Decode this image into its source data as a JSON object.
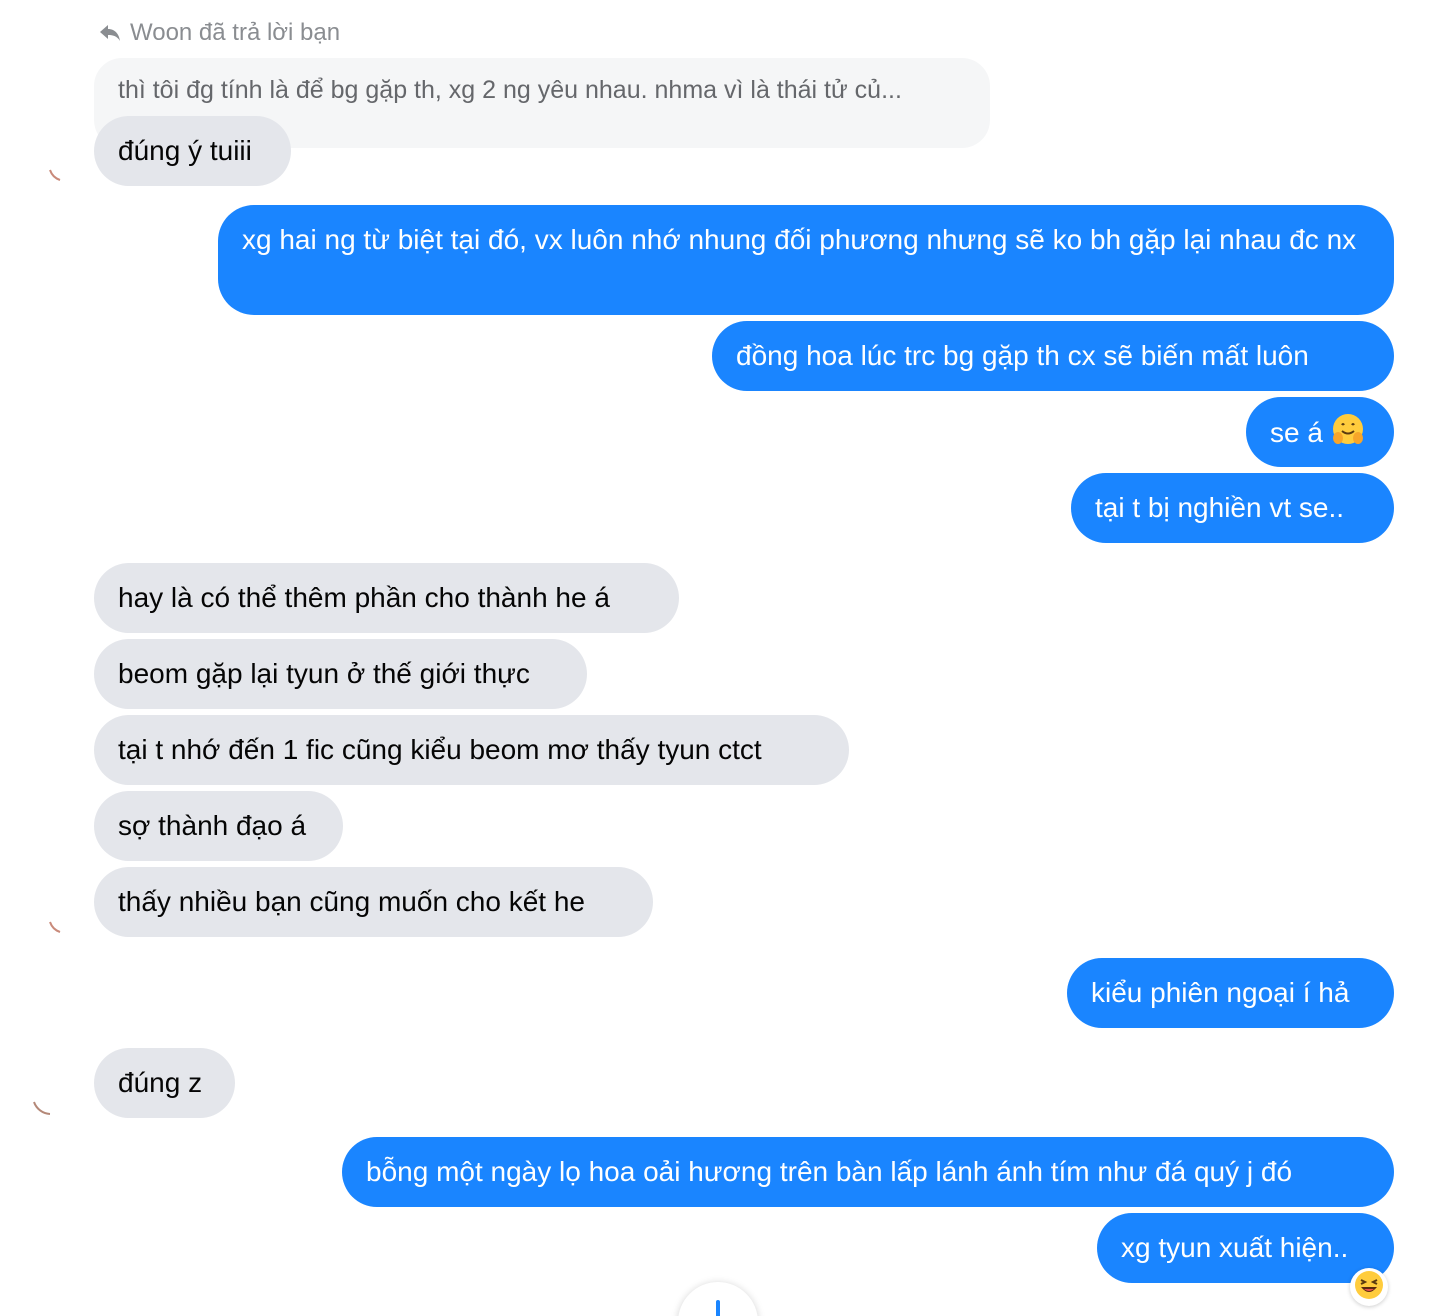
{
  "reply_note": {
    "icon": "reply-arrow-icon",
    "text": "Woon đã trả lời bạn"
  },
  "quoted_message": "thì tôi đg tính là để bg gặp th, xg 2 ng yêu nhau. nhma vì là thái tử củ...",
  "messages": [
    {
      "side": "in",
      "text": "đúng ý tuiii"
    },
    {
      "side": "out",
      "text": "xg hai ng từ biệt tại đó, vx luôn nhớ nhung đối phương nhưng sẽ ko bh gặp lại nhau đc nx"
    },
    {
      "side": "out",
      "text": "đồng hoa lúc trc bg gặp th cx sẽ biến mất luôn"
    },
    {
      "side": "out",
      "text": "se á",
      "emoji": "hugging-face-emoji"
    },
    {
      "side": "out",
      "text": "tại t bị nghiền vt se.."
    },
    {
      "side": "in",
      "text": "hay là có thể thêm phần cho thành he á"
    },
    {
      "side": "in",
      "text": "beom gặp lại tyun ở thế giới thực"
    },
    {
      "side": "in",
      "text": "tại t nhớ đến 1 fic cũng kiểu beom mơ thấy tyun ctct"
    },
    {
      "side": "in",
      "text": "sợ thành đạo á"
    },
    {
      "side": "in",
      "text": "thấy nhiều bạn cũng muốn cho kết he"
    },
    {
      "side": "out",
      "text": "kiểu phiên ngoại í hả"
    },
    {
      "side": "in",
      "text": "đúng z"
    },
    {
      "side": "out",
      "text": "bỗng một ngày lọ hoa oải hương trên bàn lấp lánh ánh tím như đá quý j đó"
    },
    {
      "side": "out",
      "text": "xg tyun xuất hiện..",
      "reaction": "laughing-emoji"
    }
  ],
  "colors": {
    "outgoing_bubble": "#1a85ff",
    "incoming_bubble": "#e4e6eb",
    "quoted_bubble": "#f5f6f7",
    "meta_text": "#8a8d91"
  }
}
